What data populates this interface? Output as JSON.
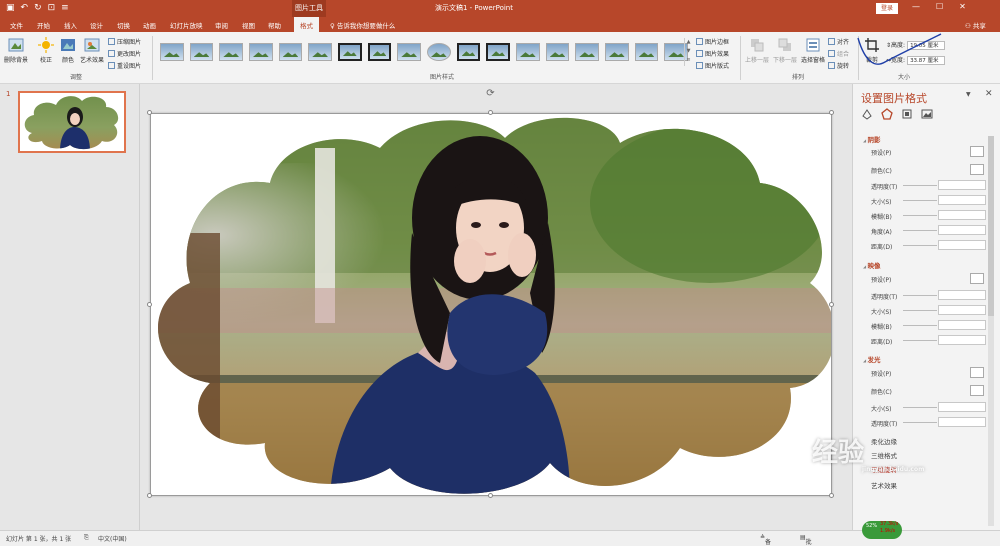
{
  "titlebar": {
    "doc_title": "演示文稿1 - PowerPoint",
    "tools_tag": "图片工具",
    "login": "登录",
    "win_min": "—",
    "win_max": "☐",
    "win_close": "✕"
  },
  "tabs": {
    "file": "文件",
    "home": "开始",
    "insert": "插入",
    "design": "设计",
    "transitions": "切换",
    "animations": "动画",
    "slideshow": "幻灯片放映",
    "review": "审阅",
    "view": "视图",
    "help": "帮助",
    "format": "格式",
    "tellme": "告诉我你想要做什么",
    "share": "共享"
  },
  "ribbon": {
    "remove_bg": "删除背景",
    "corrections": "校正",
    "color": "颜色",
    "artistic": "艺术效果",
    "compress": "压缩图片",
    "change": "更改图片",
    "reset": "重设图片",
    "adjust_group": "调整",
    "styles_group": "图片样式",
    "picture_border": "图片边框",
    "picture_effects": "图片效果",
    "picture_layout": "图片版式",
    "bring_forward": "上移一层",
    "send_backward": "下移一层",
    "selection_pane": "选择窗格",
    "align": "对齐",
    "group": "组合",
    "rotate": "旋转",
    "arrange_group": "排列",
    "crop": "裁剪",
    "height_label": "高度:",
    "height_value": "19.05 厘米",
    "width_label": "宽度:",
    "width_value": "33.87 厘米",
    "size_group": "大小"
  },
  "slides": {
    "number": "1"
  },
  "pane": {
    "title": "设置图片格式",
    "close": "✕",
    "shadow": {
      "header": "阴影",
      "preset": "预设(P)",
      "color": "颜色(C)",
      "transparency": "透明度(T)",
      "size": "大小(S)",
      "blur": "模糊(B)",
      "angle": "角度(A)",
      "distance": "距离(D)"
    },
    "reflection": {
      "header": "映像",
      "preset": "预设(P)",
      "transparency": "透明度(T)",
      "size": "大小(S)",
      "blur": "模糊(B)",
      "distance": "距离(D)"
    },
    "glow": {
      "header": "发光",
      "preset": "预设(P)",
      "color": "颜色(C)",
      "size": "大小(S)",
      "transparency": "透明度(T)"
    },
    "soft_edges": "柔化边缘",
    "format_3d": "三维格式",
    "rotation_3d": "三维旋转",
    "artistic_effects": "艺术效果"
  },
  "statusbar": {
    "slide_info": "幻灯片 第 1 张，共 1 张",
    "language": "中文(中国)",
    "notes": "备注",
    "comments": "批注"
  },
  "network": {
    "percent": "52%",
    "up": "37.3k/s",
    "down": "1.9k/s"
  },
  "watermark": {
    "text": "经验",
    "url": "jingyan.baidu.com"
  },
  "colors": {
    "accent": "#b7472a",
    "pane_bg": "#f3f3f3",
    "canvas_bg": "#e6e6e6"
  }
}
